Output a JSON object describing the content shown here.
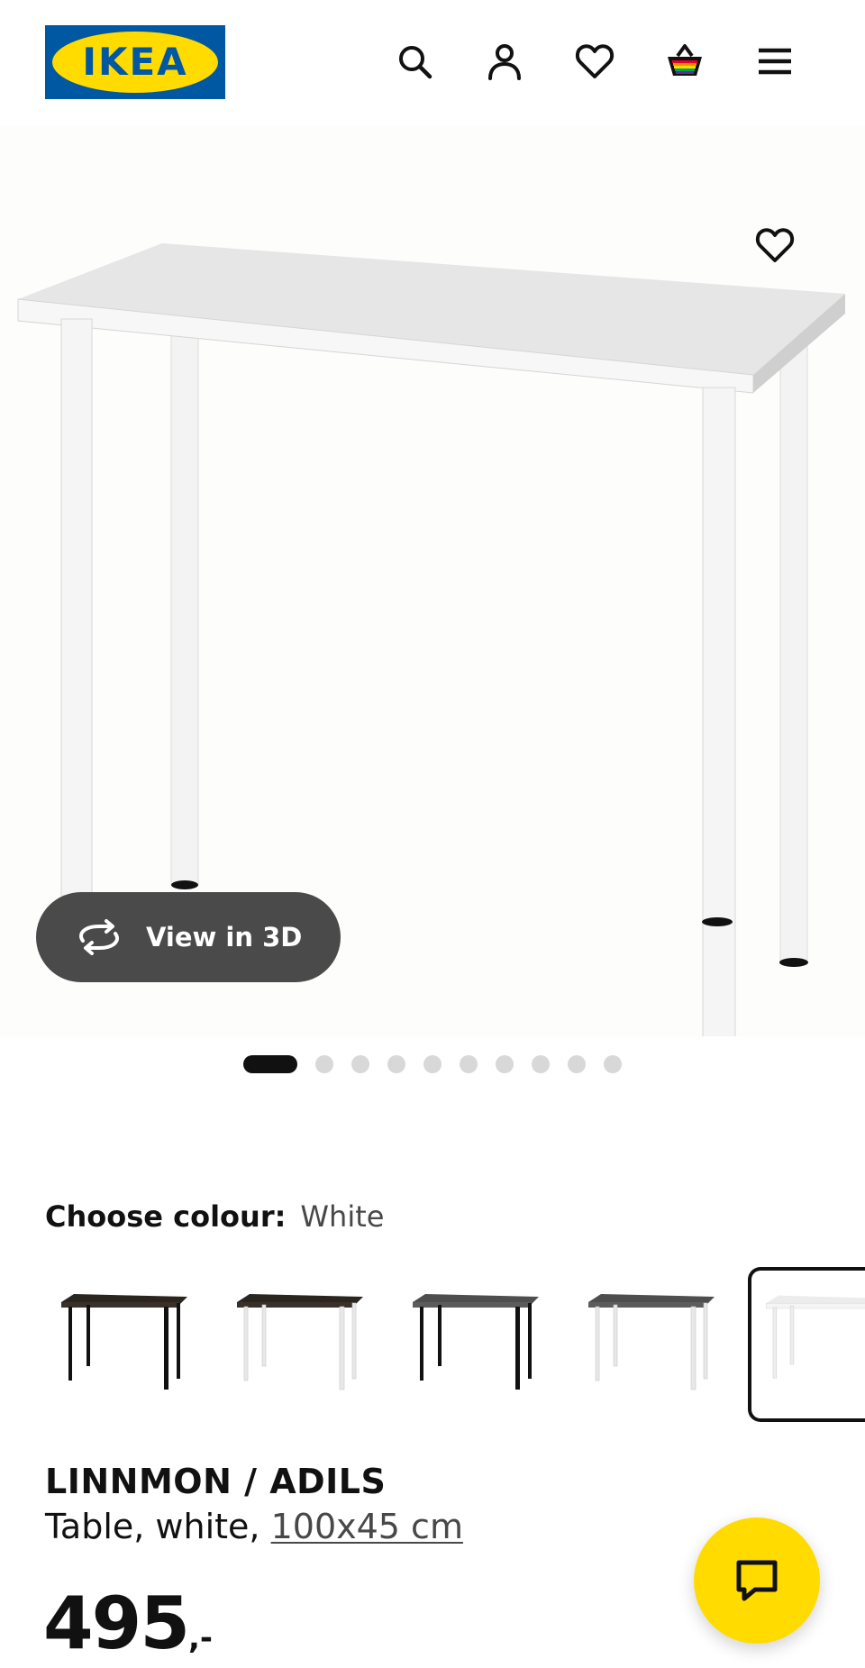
{
  "header": {
    "logo_text": "IKEA",
    "icons": [
      "search-icon",
      "account-icon",
      "favourites-icon",
      "shopping-bag-icon",
      "menu-icon"
    ]
  },
  "hero": {
    "view3d_label": "View in 3D",
    "favourite_icon": "heart-icon",
    "gallery_total": 10,
    "gallery_active": 1
  },
  "colour": {
    "label": "Choose colour:",
    "value": "White",
    "swatches": [
      {
        "top": "black-brown",
        "legs": "black"
      },
      {
        "top": "black-brown",
        "legs": "white"
      },
      {
        "top": "dark grey",
        "legs": "black"
      },
      {
        "top": "dark grey",
        "legs": "white"
      },
      {
        "top": "white",
        "legs": "white",
        "selected": true
      }
    ]
  },
  "product": {
    "name": "LINNMON / ADILS",
    "desc_prefix": "Table, white, ",
    "size": "100x45 cm",
    "price_int": "495",
    "price_dec": ",-"
  },
  "chat": {
    "icon": "chat-icon"
  },
  "colors": {
    "ikea_blue": "#0058a3",
    "ikea_yellow": "#ffdb00",
    "text": "#111111"
  }
}
